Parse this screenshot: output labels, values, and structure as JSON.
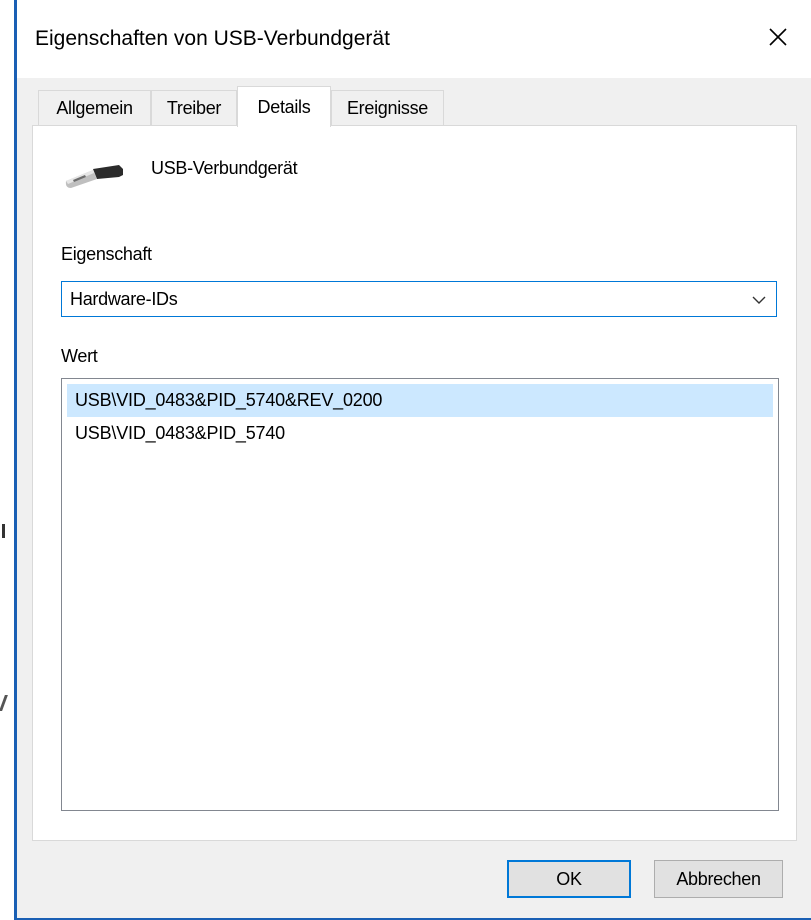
{
  "window": {
    "title": "Eigenschaften von USB-Verbundgerät"
  },
  "tabs": [
    {
      "label": "Allgemein"
    },
    {
      "label": "Treiber"
    },
    {
      "label": "Details"
    },
    {
      "label": "Ereignisse"
    }
  ],
  "active_tab": "Details",
  "device": {
    "name": "USB-Verbundgerät",
    "icon": "usb-plug-icon"
  },
  "property": {
    "label": "Eigenschaft",
    "selected": "Hardware-IDs"
  },
  "value": {
    "label": "Wert",
    "items": [
      "USB\\VID_0483&PID_5740&REV_0200",
      "USB\\VID_0483&PID_5740"
    ]
  },
  "buttons": {
    "ok": "OK",
    "cancel": "Abbrechen"
  },
  "colors": {
    "accent": "#0078d7",
    "selection": "#cce8ff",
    "dialog_bg": "#f0f0f0"
  }
}
